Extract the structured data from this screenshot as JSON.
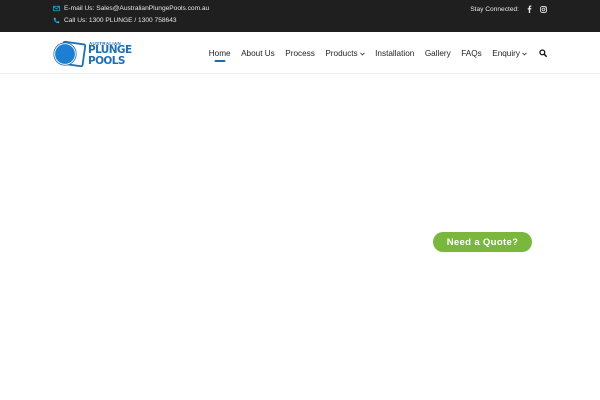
{
  "topbar": {
    "email_text": "E-mail Us: Sales@AustralianPlungePools.com.au",
    "phone_text": "Call Us: 1300 PLUNGE / 1300 758643",
    "stay_connected": "Stay Connected:",
    "social_icons": [
      "facebook-icon",
      "instagram-icon"
    ]
  },
  "logo": {
    "small": "AUSTRALIAN",
    "line1": "PLUNGE",
    "line2": "POOLS",
    "colors": {
      "brand_blue": "#1f6fb4",
      "circle_blue": "#1d7fd0"
    }
  },
  "nav": {
    "items": [
      {
        "label": "Home",
        "active": true,
        "dropdown": false
      },
      {
        "label": "About Us",
        "active": false,
        "dropdown": false
      },
      {
        "label": "Process",
        "active": false,
        "dropdown": false
      },
      {
        "label": "Products",
        "active": false,
        "dropdown": true
      },
      {
        "label": "Installation",
        "active": false,
        "dropdown": false
      },
      {
        "label": "Gallery",
        "active": false,
        "dropdown": false
      },
      {
        "label": "FAQs",
        "active": false,
        "dropdown": false
      },
      {
        "label": "Enquiry",
        "active": false,
        "dropdown": true
      }
    ],
    "search_icon": "search-icon",
    "accent": "#1a6bb0"
  },
  "cta": {
    "quote_label": "Need a Quote?",
    "color": "#7ab73d"
  }
}
